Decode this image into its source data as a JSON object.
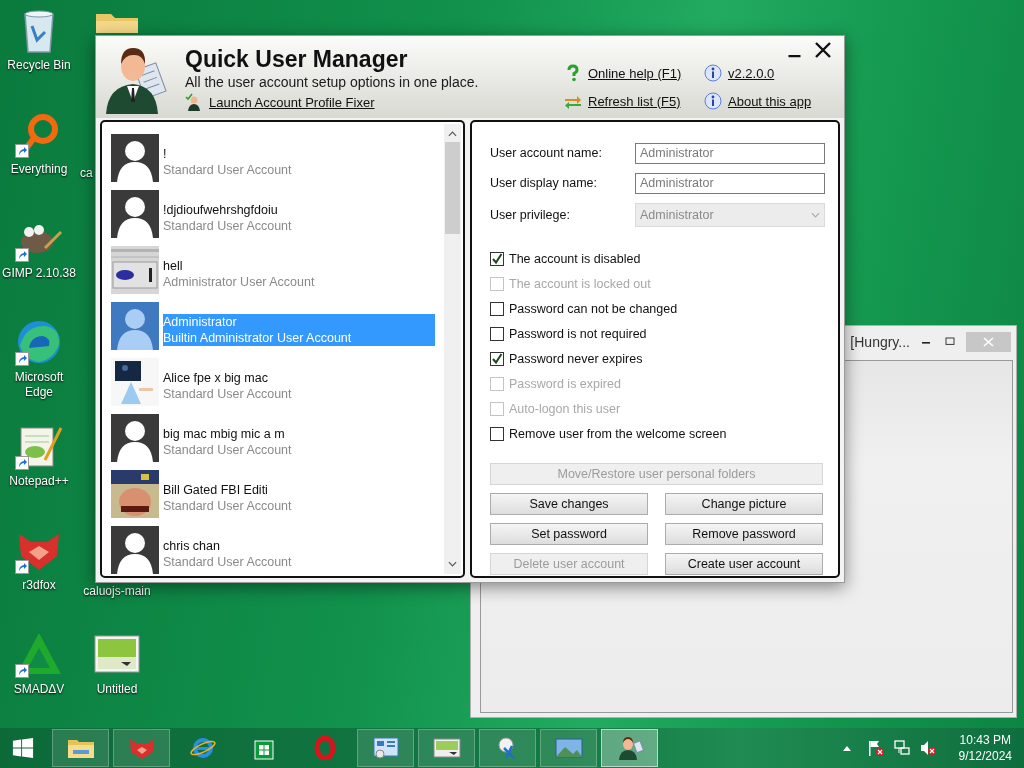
{
  "desktop": {
    "icons": [
      {
        "label": "Recycle Bin",
        "kind": "recycle-bin",
        "shortcut": false
      },
      {
        "label": "Everything",
        "kind": "everything",
        "shortcut": true
      },
      {
        "label": "GIMP 2.10.38",
        "kind": "gimp",
        "shortcut": true
      },
      {
        "label": "Microsoft Edge",
        "kind": "edge",
        "shortcut": true
      },
      {
        "label": "Notepad++",
        "kind": "notepad",
        "shortcut": true
      },
      {
        "label": "r3dfox",
        "kind": "r3dfox",
        "shortcut": true
      },
      {
        "label": "SMADΔV",
        "kind": "smadav",
        "shortcut": true
      },
      {
        "kind": "covered-folder",
        "shortcut": false
      },
      {
        "label": "ca",
        "kind": "covered"
      },
      {
        "label": "caluojs-main",
        "kind": "covered-label"
      },
      {
        "label": "Untitled",
        "kind": "image-file",
        "shortcut": false
      }
    ]
  },
  "background_window": {
    "title": "[Hungry..."
  },
  "app": {
    "title": "Quick User Manager",
    "subtitle": "All the user account setup options in one place.",
    "profile_fixer_link": "Launch Account Profile Fixer",
    "links": [
      {
        "label": "Online help (F1)",
        "kind": "help"
      },
      {
        "label": "v2.2.0.0",
        "kind": "info"
      },
      {
        "label": "Refresh list (F5)",
        "kind": "refresh"
      },
      {
        "label": "About this app",
        "kind": "info"
      }
    ],
    "users": [
      {
        "name": "!",
        "type": "Standard User Account",
        "kind": "silhouette",
        "selected": false
      },
      {
        "name": "!djdioufwehrshgfdoiu",
        "type": "Standard User Account",
        "kind": "silhouette",
        "selected": false
      },
      {
        "name": "hell",
        "type": "Administrator User Account",
        "kind": "picture",
        "selected": false
      },
      {
        "name": "Administrator",
        "type": "Builtin Administrator User Account",
        "kind": "silhouette",
        "selected": true
      },
      {
        "name": "Alice fpe x big mac",
        "type": "Standard User Account",
        "kind": "picture",
        "selected": false
      },
      {
        "name": "big mac mbig mic a m",
        "type": "Standard User Account",
        "kind": "silhouette",
        "selected": false
      },
      {
        "name": "Bill Gated FBI Editi",
        "type": "Standard User Account",
        "kind": "picture",
        "selected": false
      },
      {
        "name": "chris chan",
        "type": "Standard User Account",
        "kind": "silhouette",
        "selected": false
      }
    ],
    "form": {
      "fields": [
        {
          "label": "User account name:",
          "value": "Administrator",
          "kind": "text",
          "disabled": false
        },
        {
          "label": "User display name:",
          "value": "Administrator",
          "kind": "text",
          "disabled": false
        },
        {
          "label": "User privilege:",
          "value": "Administrator",
          "kind": "select",
          "disabled": true
        }
      ],
      "checks": [
        {
          "label": "The account is disabled",
          "checked": true,
          "disabled": false
        },
        {
          "label": "The account is locked out",
          "checked": false,
          "disabled": true
        },
        {
          "label": "Password can not be changed",
          "checked": false,
          "disabled": false
        },
        {
          "label": "Password is not required",
          "checked": false,
          "disabled": false
        },
        {
          "label": "Password never expires",
          "checked": true,
          "disabled": false
        },
        {
          "label": "Password is expired",
          "checked": false,
          "disabled": true
        },
        {
          "label": "Auto-logon this user",
          "checked": false,
          "disabled": true
        },
        {
          "label": "Remove user from the welcome screen",
          "checked": false,
          "disabled": false
        }
      ],
      "buttons": [
        {
          "label": "Move/Restore user personal folders",
          "kind": "wide",
          "disabled": true
        },
        {
          "label": "Save changes",
          "kind": "normal",
          "disabled": false
        },
        {
          "label": "Change picture",
          "kind": "normal",
          "disabled": false
        },
        {
          "label": "Set password",
          "kind": "normal",
          "disabled": false
        },
        {
          "label": "Remove password",
          "kind": "normal",
          "disabled": false
        },
        {
          "label": "Delete user account",
          "kind": "normal",
          "disabled": true
        },
        {
          "label": "Create user account",
          "kind": "normal",
          "disabled": false
        }
      ]
    }
  },
  "taskbar": {
    "items": [
      {
        "kind": "explorer",
        "running": true,
        "selected": false
      },
      {
        "kind": "r3dfox",
        "running": true,
        "selected": false
      },
      {
        "kind": "ie",
        "running": false,
        "selected": false
      },
      {
        "kind": "store",
        "running": false,
        "selected": false
      },
      {
        "kind": "opera",
        "running": false,
        "selected": false
      },
      {
        "kind": "control-panel",
        "running": true,
        "selected": false
      },
      {
        "kind": "image-viewer",
        "running": true,
        "selected": false
      },
      {
        "kind": "snipping",
        "running": true,
        "selected": false
      },
      {
        "kind": "photos",
        "running": true,
        "selected": false
      },
      {
        "kind": "user-manager",
        "running": true,
        "selected": true
      }
    ],
    "clock": {
      "time": "10:43 PM",
      "date": "9/12/2024"
    }
  }
}
